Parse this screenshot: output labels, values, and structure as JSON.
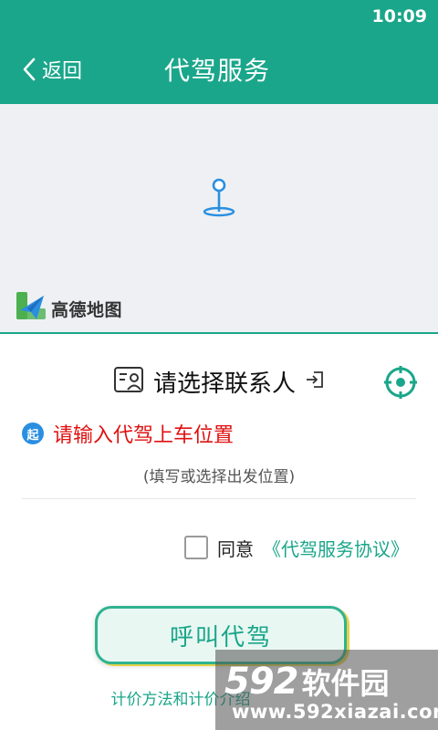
{
  "status_bar": {
    "time": "10:09"
  },
  "header": {
    "back_label": "返回",
    "title": "代驾服务"
  },
  "colors": {
    "primary": "#1aa68a",
    "pickup_red": "#e01010",
    "badge_blue": "#2a8fe0"
  },
  "map": {
    "logo_text": "高德地图",
    "pin_icon": "location-pin-icon"
  },
  "panel": {
    "contact_label": "请选择联系人",
    "pickup_badge": "起",
    "pickup_label": "请输入代驾上车位置",
    "pickup_hint": "(填写或选择出发位置)",
    "agree_label": "同意",
    "agreement_link": "《代驾服务协议》",
    "agree_checked": false,
    "call_button": "呼叫代驾",
    "pricing_link": "计价方法和计价介绍"
  },
  "watermark": {
    "number": "592",
    "name": "软件园",
    "url": "www.592xiazai.com"
  }
}
